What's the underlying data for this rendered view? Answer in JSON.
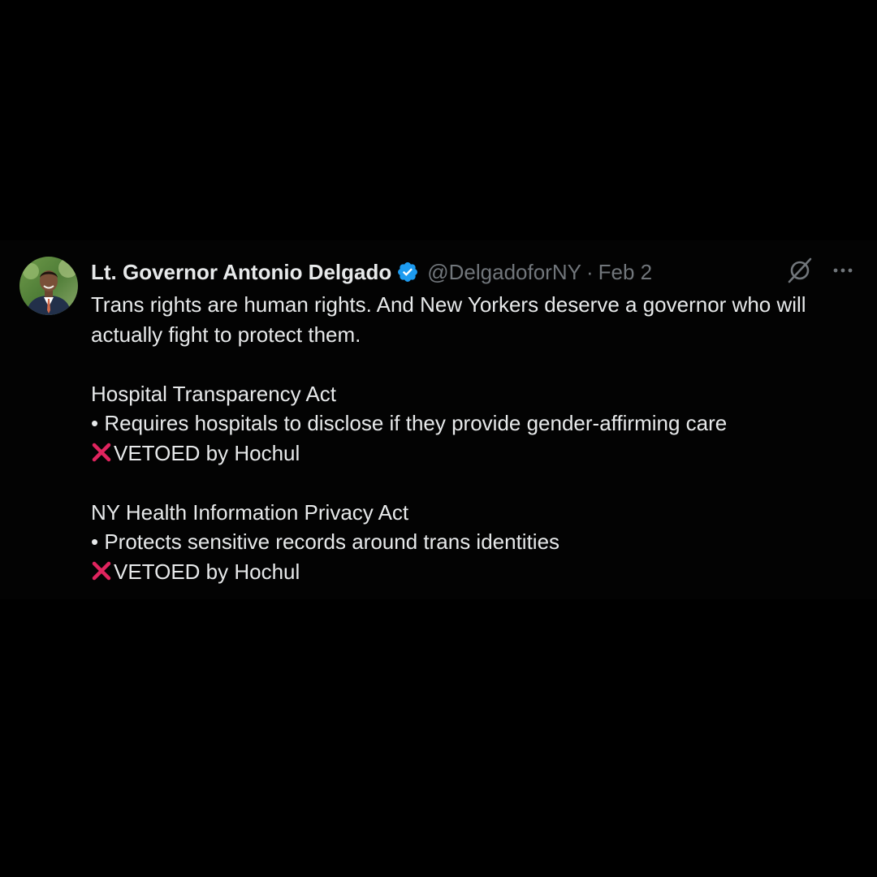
{
  "tweet": {
    "author": {
      "display_name": "Lt. Governor Antonio Delgado",
      "handle": "@DelgadoforNY",
      "verified": true,
      "avatar": "profile-photo"
    },
    "separator": "·",
    "date": "Feb 2",
    "icons": {
      "grok": "grok-icon",
      "more": "more-icon",
      "verified": "verified-badge-icon",
      "cross": "red-cross-mark-icon"
    },
    "text": {
      "line1": "Trans rights are human rights. And New Yorkers deserve a governor who will",
      "line2": "actually fight to protect them.",
      "act1_title": "Hospital Transparency Act",
      "act1_desc": "• Requires hospitals to disclose if they provide gender-affirming care",
      "act1_status": "VETOED by Hochul",
      "act2_title": "NY Health Information Privacy Act",
      "act2_desc": "• Protects sensitive records around trans identities",
      "act2_status": "VETOED by Hochul"
    }
  },
  "colors": {
    "background": "#000000",
    "text_primary": "#e7e9ea",
    "text_secondary": "#71767b",
    "verified_blue": "#1d9bf0",
    "cross_red": "#e0245e"
  }
}
